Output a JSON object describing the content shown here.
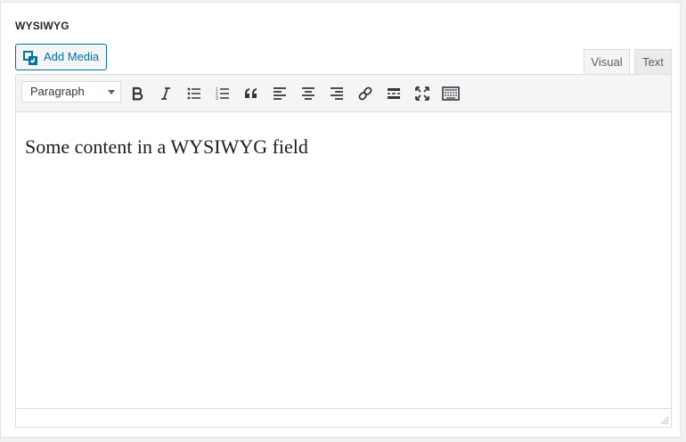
{
  "field": {
    "label": "WYSIWYG"
  },
  "media": {
    "add_label": "Add Media"
  },
  "tabs": {
    "visual": "Visual",
    "text": "Text"
  },
  "toolbar": {
    "format_value": "Paragraph",
    "buttons": [
      "bold-icon",
      "italic-icon",
      "bullet-list-icon",
      "numbered-list-icon",
      "blockquote-icon",
      "align-left-icon",
      "align-center-icon",
      "align-right-icon",
      "link-icon",
      "read-more-icon",
      "fullscreen-icon",
      "toolbar-toggle-icon"
    ]
  },
  "editor": {
    "content": "Some content in a WYSIWYG field"
  },
  "colors": {
    "accent": "#0071a1",
    "border": "#dcdcde",
    "toolbar_bg": "#f5f5f5"
  }
}
